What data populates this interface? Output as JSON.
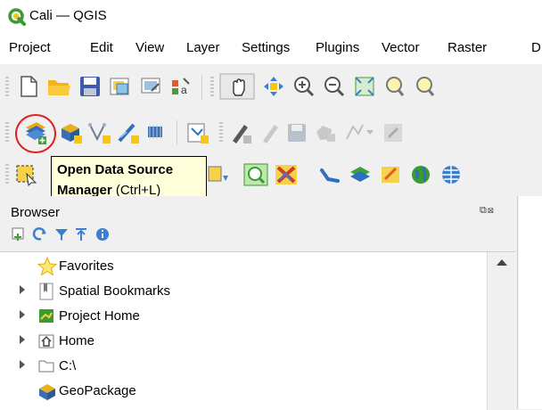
{
  "window": {
    "title": "Cali — QGIS"
  },
  "menu": [
    "Project",
    "Edit",
    "View",
    "Layer",
    "Settings",
    "Plugins",
    "Vector",
    "Raster",
    "D"
  ],
  "tooltip": {
    "title": "Open Data Source Manager",
    "shortcut": "(Ctrl+L)",
    "line1": "Open Data Source",
    "line2": "Manager"
  },
  "browser": {
    "title": "Browser",
    "items": [
      {
        "label": "Favorites",
        "icon": "star-icon"
      },
      {
        "label": "Spatial Bookmarks",
        "icon": "bookmark-icon"
      },
      {
        "label": "Project Home",
        "icon": "project-home-icon"
      },
      {
        "label": "Home",
        "icon": "home-icon"
      },
      {
        "label": "C:\\",
        "icon": "drive-icon"
      },
      {
        "label": "GeoPackage",
        "icon": "geopackage-icon"
      }
    ]
  }
}
